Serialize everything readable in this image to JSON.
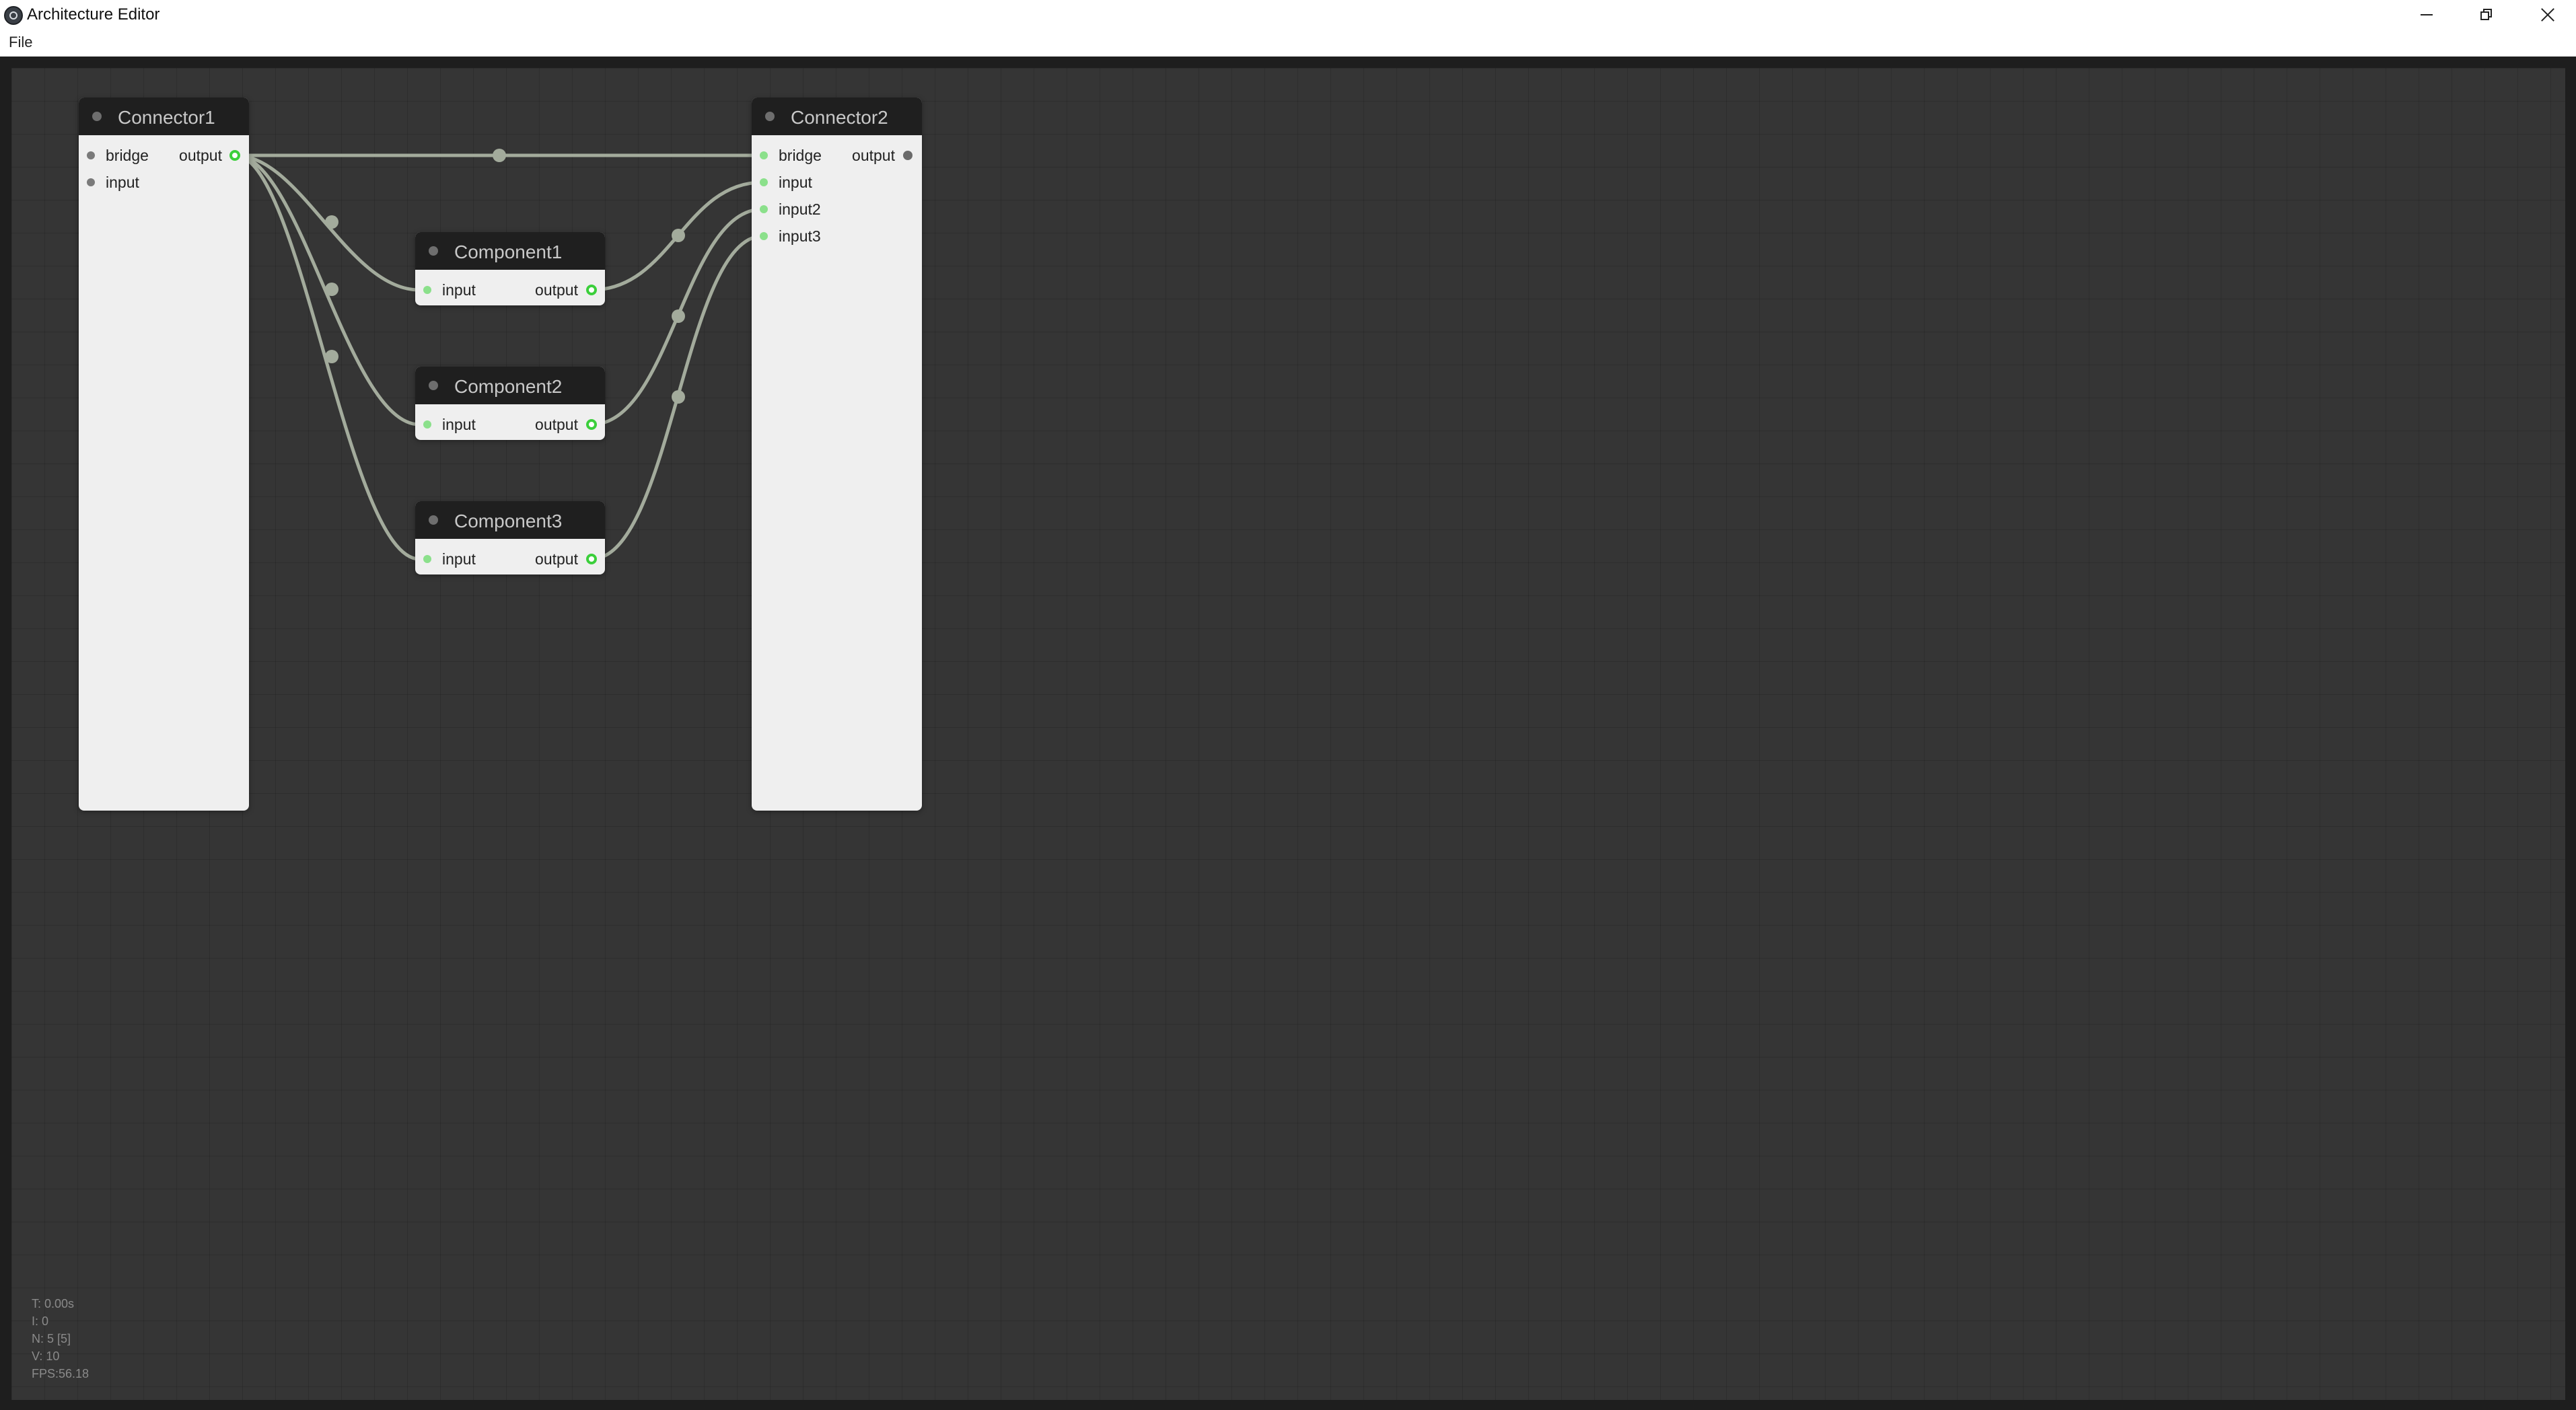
{
  "window": {
    "title": "Architecture Editor",
    "controls": [
      "minimize",
      "restore",
      "close"
    ]
  },
  "menu": {
    "items": [
      "File"
    ]
  },
  "colors": {
    "canvas_bg": "#353535",
    "node_body": "#efefef",
    "node_header": "#1f1f1f",
    "link": "#a3ab9c",
    "connected_slot": "#8be08b",
    "output_ring": "#3bcf3b"
  },
  "nodes": [
    {
      "id": "connector1",
      "title": "Connector1",
      "inputs": [
        "bridge",
        "input"
      ],
      "output": "output"
    },
    {
      "id": "component1",
      "title": "Component1",
      "inputs": [
        "input"
      ],
      "output": "output"
    },
    {
      "id": "component2",
      "title": "Component2",
      "inputs": [
        "input"
      ],
      "output": "output"
    },
    {
      "id": "component3",
      "title": "Component3",
      "inputs": [
        "input"
      ],
      "output": "output"
    },
    {
      "id": "connector2",
      "title": "Connector2",
      "inputs": [
        "bridge",
        "input",
        "input2",
        "input3"
      ],
      "output": "output"
    }
  ],
  "links": [
    {
      "from": "Connector1.output",
      "to": "Connector2.bridge"
    },
    {
      "from": "Connector1.output",
      "to": "Component1.input"
    },
    {
      "from": "Connector1.output",
      "to": "Component2.input"
    },
    {
      "from": "Connector1.output",
      "to": "Component3.input"
    },
    {
      "from": "Component1.output",
      "to": "Connector2.input"
    },
    {
      "from": "Component2.output",
      "to": "Connector2.input2"
    },
    {
      "from": "Component3.output",
      "to": "Connector2.input3"
    }
  ],
  "stats": {
    "t": "T: 0.00s",
    "i": "I: 0",
    "n": "N: 5 [5]",
    "v": "V: 10",
    "fps": "FPS:56.18"
  }
}
